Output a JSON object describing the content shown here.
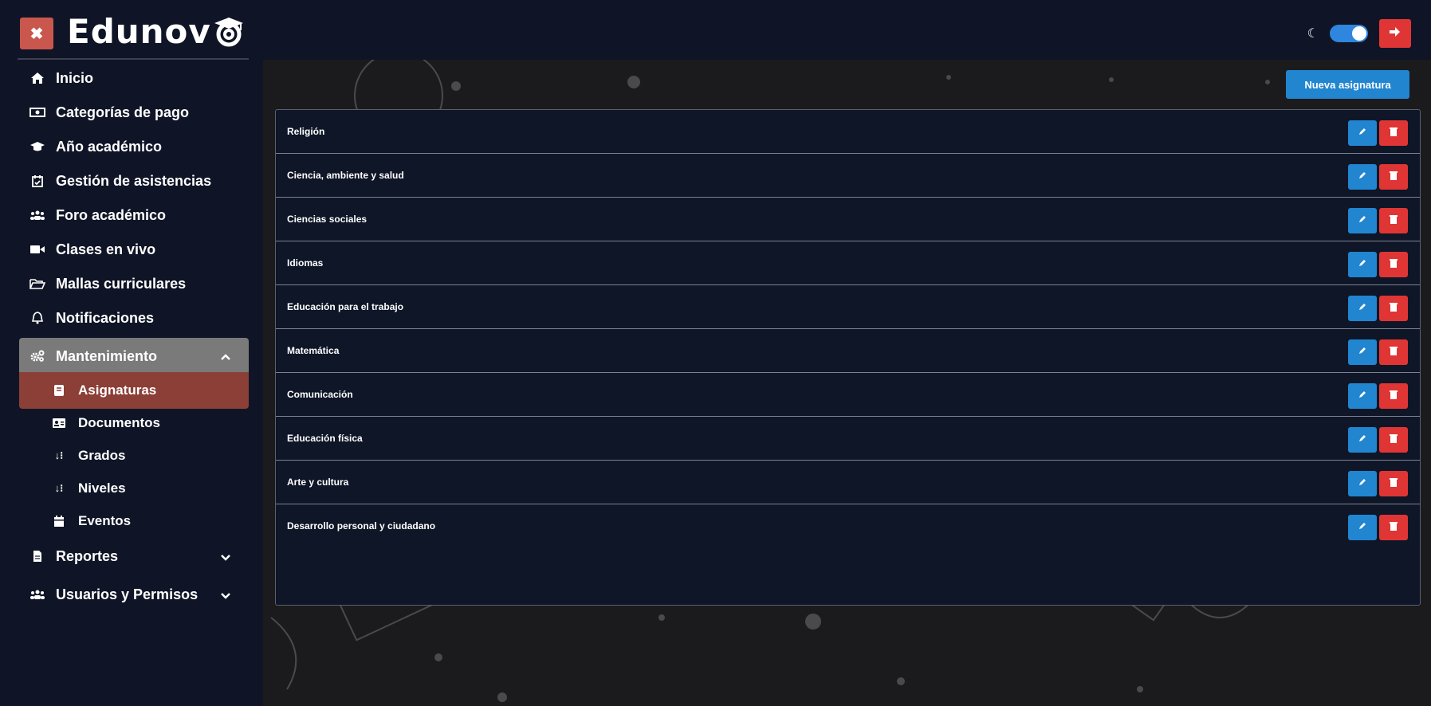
{
  "app": {
    "logo_text": "Edunov",
    "theme_toggle_state": "dark"
  },
  "sidebar": {
    "items": [
      {
        "label": "Inicio",
        "icon": "home-icon"
      },
      {
        "label": "Categorías de pago",
        "icon": "money-bill-icon"
      },
      {
        "label": "Año académico",
        "icon": "graduation-cap-icon"
      },
      {
        "label": "Gestión de asistencias",
        "icon": "calendar-check-icon"
      },
      {
        "label": "Foro académico",
        "icon": "users-icon"
      },
      {
        "label": "Clases en vivo",
        "icon": "video-icon"
      },
      {
        "label": "Mallas curriculares",
        "icon": "folder-open-icon"
      },
      {
        "label": "Notificaciones",
        "icon": "bell-icon"
      },
      {
        "label": "Mantenimiento",
        "icon": "cogs-icon",
        "expanded": true
      },
      {
        "label": "Reportes",
        "icon": "file-icon",
        "expanded": false
      },
      {
        "label": "Usuarios y Permisos",
        "icon": "users-icon",
        "expanded": false
      }
    ],
    "maintenance_subitems": [
      {
        "label": "Asignaturas",
        "icon": "book-icon",
        "active": true
      },
      {
        "label": "Documentos",
        "icon": "id-card-icon"
      },
      {
        "label": "Grados",
        "icon": "sort-numeric-icon"
      },
      {
        "label": "Niveles",
        "icon": "sort-numeric-icon"
      },
      {
        "label": "Eventos",
        "icon": "calendar-icon"
      }
    ]
  },
  "main": {
    "new_button_label": "Nueva asignatura",
    "subjects": [
      "Religión",
      "Ciencia, ambiente y salud",
      "Ciencias sociales",
      "Idiomas",
      "Educación para el trabajo",
      "Matemática",
      "Comunicación",
      "Educación física",
      "Arte y cultura",
      "Desarrollo personal y ciudadano"
    ]
  },
  "colors": {
    "sidebar_bg": "#0f1526",
    "accent_blue": "#2185d0",
    "danger_red": "#e03535",
    "active_item": "#8b3f36",
    "open_group": "#7a7a7a"
  }
}
